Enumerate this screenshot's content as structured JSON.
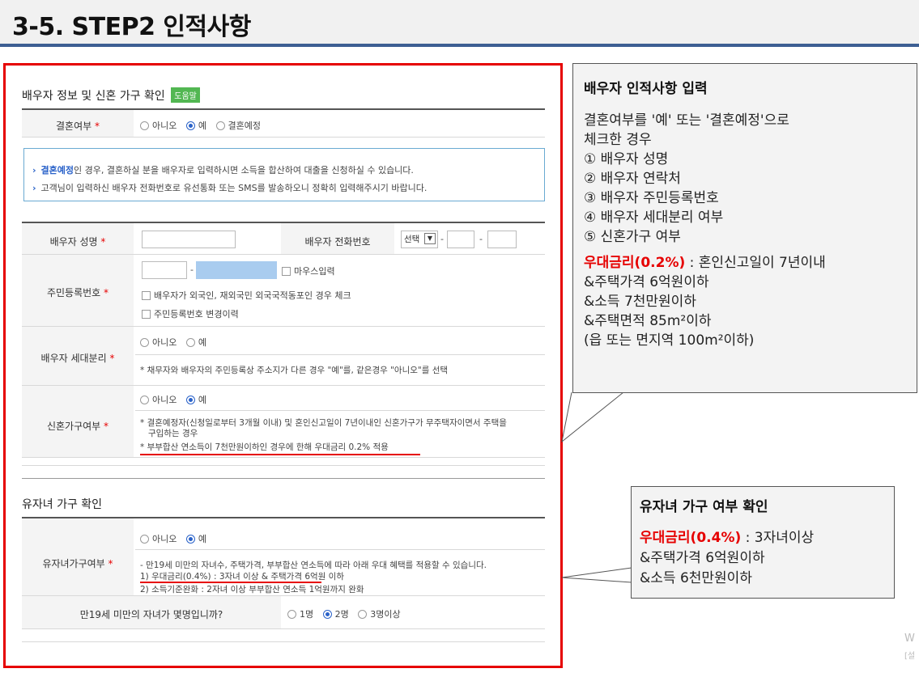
{
  "header": {
    "title": "3-5. STEP2 인적사항"
  },
  "spouse_section": {
    "title": "배우자 정보 및 신혼 가구 확인",
    "help_badge": "도움말",
    "marriage_label": "결혼여부",
    "marriage_options": [
      "아니오",
      "예",
      "결혼예정"
    ],
    "notice_line1_highlight": "결혼예정",
    "notice_line1_rest": "인 경우, 결혼하실 분을 배우자로 입력하시면 소득을 합산하여 대출을 신청하실 수 있습니다.",
    "notice_line2": "고객님이 입력하신 배우자 전화번호로 유선통화 또는 SMS를 발송하오니 정확히 입력해주시기 바랍니다.",
    "name_label": "배우자 성명",
    "phone_label": "배우자 전화번호",
    "phone_select": "선택",
    "rrn_label": "주민등록번호",
    "mouse_input": "마우스입력",
    "foreign_check": "배우자가 외국인, 재외국민 외국국적동포인 경우 체크",
    "rrn_change_check": "주민등록번호 변경이력",
    "household_label": "배우자 세대분리",
    "household_options": [
      "아니오",
      "예"
    ],
    "household_note": "* 채무자와 배우자의 주민등록상 주소지가 다른 경우 \"예\"를, 같은경우 \"아니오\"를 선택",
    "newlywed_label": "신혼가구여부",
    "newlywed_options": [
      "아니오",
      "예"
    ],
    "newlywed_note1": "* 결혼예정자(신청일로부터 3개월 이내) 및 혼인신고일이 7년이내인 신혼가구가 무주택자이면서 주택을",
    "newlywed_note2": "구입하는 경우",
    "newlywed_note3": "부부합산 연소득이 7천만원이하인 경우에 한해 우대금리 0.2% 적용"
  },
  "children_section": {
    "title": "유자녀 가구 확인",
    "label": "유자녀가구여부",
    "options": [
      "아니오",
      "예"
    ],
    "note1": "- 만19세 미만의 자녀수, 주택가격, 부부합산 연소득에 따라 아래 우대 혜택를 적용할 수 있습니다.",
    "note2": "1) 우대금리(0.4%) : 3자녀 이상 & 주택가격 6억원 이하",
    "note3": "2) 소득기준완화 : 2자녀 이상 부부합산 연소득 1억원까지 완화",
    "count_label": "만19세 미만의 자녀가 몇명입니까?",
    "count_options": [
      "1명",
      "2명",
      "3명이상"
    ]
  },
  "callout1": {
    "title": "배우자 인적사항 입력",
    "line1": "결혼여부를 '예' 또는 '결혼예정'으로",
    "line2": "체크한 경우",
    "items": [
      "① 배우자 성명",
      "② 배우자 연락처",
      "③ 배우자 주민등록번호",
      "④ 배우자 세대분리 여부",
      "⑤ 신혼가구 여부"
    ],
    "rate_red": "우대금리(0.2%)",
    "rate_rest": " : 혼인신고일이 7년이내",
    "cond1": "&주택가격 6억원이하",
    "cond2": "&소득 7천만원이하",
    "cond3": "&주택면적 85m²이하",
    "cond4": "(읍 또는 면지역 100m²이하)"
  },
  "callout2": {
    "title": "유자녀 가구 여부 확인",
    "rate_red": "우대금리(0.4%)",
    "rate_rest": " : 3자녀이상",
    "cond1": "&주택가격 6억원이하",
    "cond2": "&소득 6천만원이하"
  },
  "watermark": {
    "line1": "W",
    "line2": "[설"
  },
  "colors": {
    "accent_red": "#e60000",
    "header_bar": "#3d5f93",
    "radio_blue": "#2a62c9",
    "help_green": "#52b752"
  }
}
